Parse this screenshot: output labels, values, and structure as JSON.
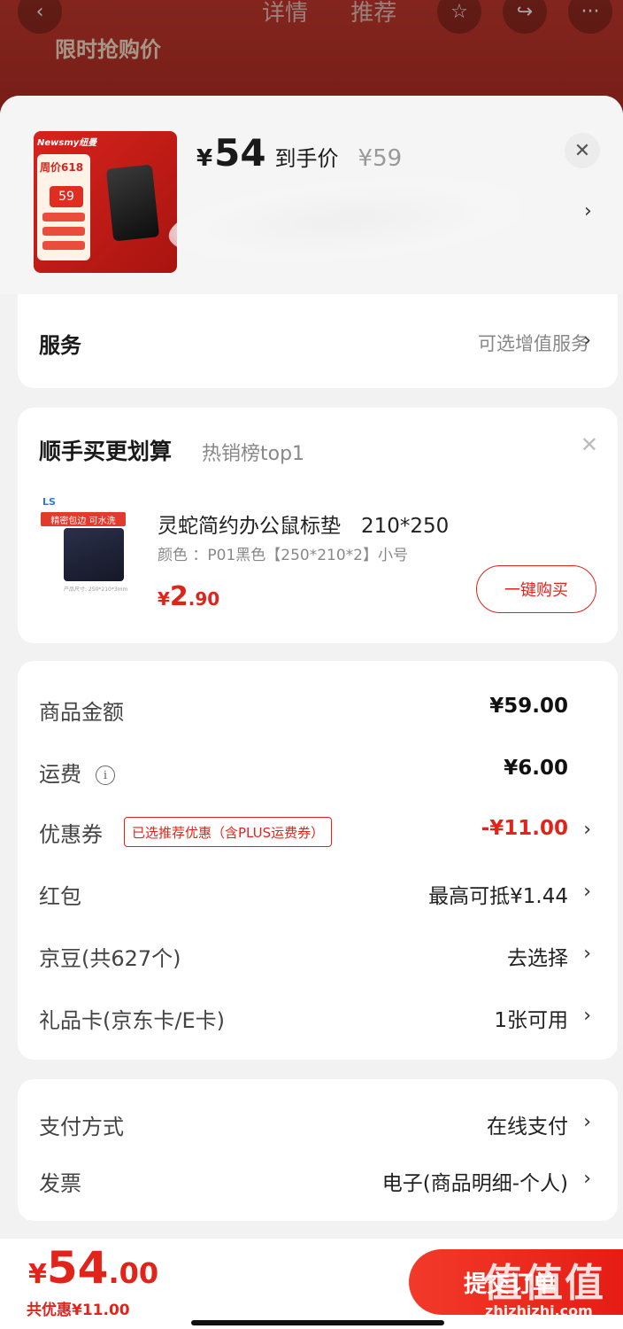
{
  "background": {
    "tabs": [
      "详情",
      "推荐"
    ],
    "flash_sale": "限时抢购价"
  },
  "product": {
    "price_symbol": "¥",
    "price": "54",
    "price_label": "到手价",
    "original_price": "¥59",
    "thumb": {
      "brand": "Newsmy纽曼",
      "promo": "周价618",
      "promo_price": "59"
    }
  },
  "service": {
    "title": "服务",
    "value": "可选增值服务"
  },
  "bundle": {
    "title": "顺手买更划算",
    "subtitle": "热销榜top1",
    "item": {
      "thumb_ribbon": "精密包边 可水洗",
      "thumb_caption": "产品尺寸: 250*210*3mm",
      "name": "灵蛇简约办公鼠标垫　210*250",
      "spec": "颜色 ：P01黑色【250*210*2】小号",
      "price_symbol": "¥",
      "price_int": "2",
      "price_dec": ".90",
      "buy_label": "一键购买"
    }
  },
  "summary": {
    "goods_label": "商品金额",
    "goods_value": "¥59.00",
    "shipping_label": "运费",
    "shipping_value": "¥6.00",
    "coupon_label": "优惠券",
    "coupon_badge": "已选推荐优惠（含PLUS运费券）",
    "coupon_value": "-¥11.00",
    "redpacket_label": "红包",
    "redpacket_value": "最高可抵¥1.44",
    "jingdou_label": "京豆(共627个)",
    "jingdou_value": "去选择",
    "giftcard_label": "礼品卡(京东卡/E卡)",
    "giftcard_value": "1张可用"
  },
  "payment": {
    "method_label": "支付方式",
    "method_value": "在线支付",
    "invoice_label": "发票",
    "invoice_value": "电子(商品明细-个人)"
  },
  "footer": {
    "total_symbol": "¥",
    "total_int": "54",
    "total_dec": ".00",
    "saved": "共优惠¥11.00",
    "submit_label": "提交订单"
  },
  "watermark": {
    "logo": "值值值",
    "site": "zhizhizhi.com"
  },
  "colors": {
    "accent": "#e2231a",
    "page_bg": "#f2f2f2"
  }
}
